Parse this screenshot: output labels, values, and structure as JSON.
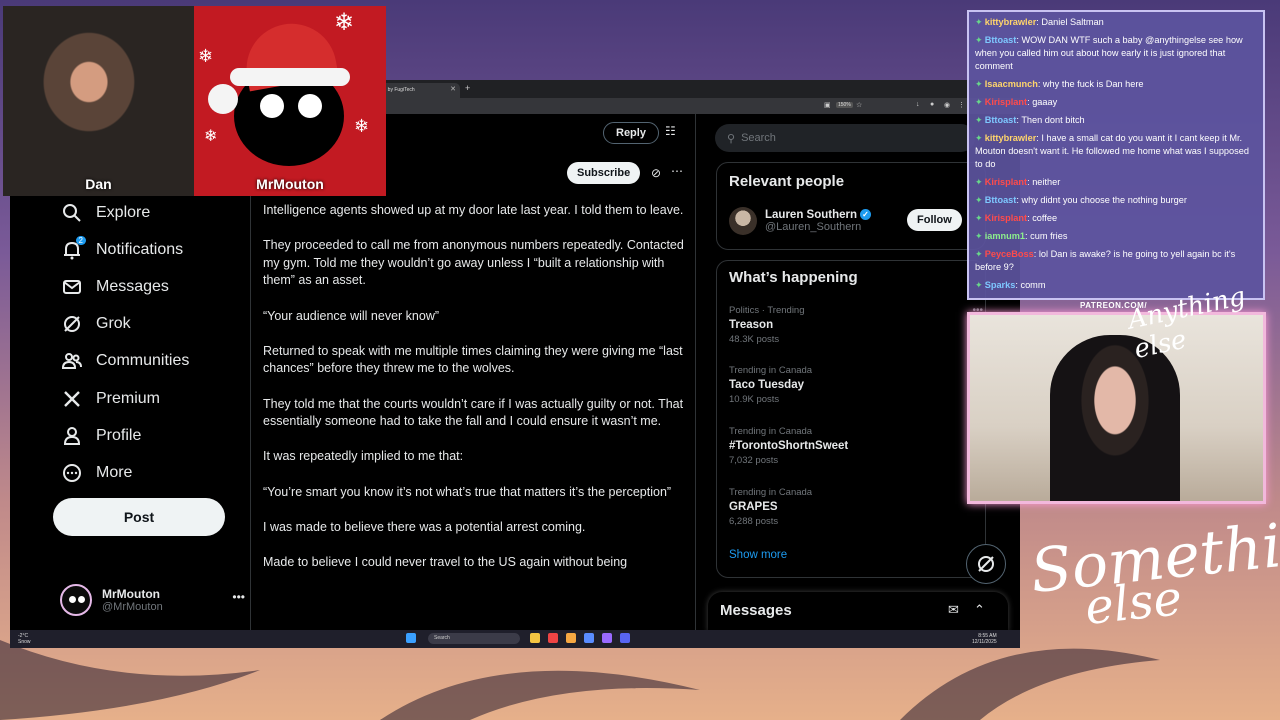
{
  "browser": {
    "tab_title": "ctive by FugiTech",
    "zoom": "150%"
  },
  "nav": {
    "items": [
      {
        "label": "Explore",
        "icon": "search-icon"
      },
      {
        "label": "Notifications",
        "icon": "bell-icon",
        "badge": "2"
      },
      {
        "label": "Messages",
        "icon": "mail-icon"
      },
      {
        "label": "Grok",
        "icon": "grok-icon"
      },
      {
        "label": "Communities",
        "icon": "people-icon"
      },
      {
        "label": "Premium",
        "icon": "x-logo-icon"
      },
      {
        "label": "Profile",
        "icon": "person-icon"
      },
      {
        "label": "More",
        "icon": "more-circle-icon"
      }
    ],
    "post_label": "Post",
    "account": {
      "name": "MrMouton",
      "handle": "@MrMouton"
    }
  },
  "center": {
    "reply_label": "Reply",
    "subscribe_label": "Subscribe",
    "tweet_paragraphs": [
      "Intelligence agents showed up at my door late last year. I told them to leave.",
      "They proceeded to call me from anonymous numbers repeatedly. Contacted my gym. Told me they wouldn’t go away unless I “built a relationship with them” as an asset.",
      "“Your audience will never know”",
      "Returned to speak with me multiple times claiming they were giving me “last chances” before they threw me to the wolves.",
      "They told me that the courts wouldn’t care if I was actually guilty or not. That essentially someone had to take the fall and I could ensure it wasn’t me.",
      "It was repeatedly implied to me that:",
      "“You’re smart you know it’s not what’s true that matters it’s the perception”",
      "I was made to believe there was a potential arrest coming.",
      "Made to believe I could never travel to the US again without being"
    ]
  },
  "right": {
    "search_placeholder": "Search",
    "relevant_title": "Relevant people",
    "person": {
      "name": "Lauren Southern",
      "handle": "@Lauren_Southern"
    },
    "follow_label": "Follow",
    "happening_title": "What’s happening",
    "trends": [
      {
        "category": "Politics · Trending",
        "name": "Treason",
        "count": "48.3K posts"
      },
      {
        "category": "Trending in Canada",
        "name": "Taco Tuesday",
        "count": "10.9K posts"
      },
      {
        "category": "Trending in Canada",
        "name": "#TorontoShortnSweet",
        "count": "7,032 posts"
      },
      {
        "category": "Trending in Canada",
        "name": "GRAPES",
        "count": "6,288 posts"
      }
    ],
    "show_more_label": "Show more",
    "messages_title": "Messages"
  },
  "taskbar": {
    "weather_temp": "-2°C",
    "weather_label": "Snow",
    "search_label": "Search",
    "time": "8:55 AM",
    "date": "12/11/2025"
  },
  "cams": {
    "dan_label": "Dan",
    "mouton_label": "MrMouton"
  },
  "chat": {
    "messages": [
      {
        "user": "kittybrawler",
        "user_color": "#ffd56b",
        "text": "Daniel Saltman"
      },
      {
        "user": "Bttoast",
        "user_color": "#7ec8ff",
        "text": "WOW DAN WTF such a baby @anythingelse see how when you called him out about how early it is just ignored that comment"
      },
      {
        "user": "Isaacmunch",
        "user_color": "#ffd56b",
        "text": "why the fuck is Dan here"
      },
      {
        "user": "Kirisplant",
        "user_color": "#ff4b4b",
        "text": "gaaay"
      },
      {
        "user": "Bttoast",
        "user_color": "#7ec8ff",
        "text": "Then dont bitch"
      },
      {
        "user": "kittybrawler",
        "user_color": "#ffd56b",
        "text": "I have a small cat do you want it I cant keep it Mr. Mouton doesn't want it. He followed me home what was I supposed to do"
      },
      {
        "user": "Kirisplant",
        "user_color": "#ff4b4b",
        "text": "neither"
      },
      {
        "user": "Bttoast",
        "user_color": "#7ec8ff",
        "text": "why didnt you choose the nothing burger"
      },
      {
        "user": "Kirisplant",
        "user_color": "#ff4b4b",
        "text": "coffee"
      },
      {
        "user": "iamnum1",
        "user_color": "#8cf08c",
        "text": "cum fries"
      },
      {
        "user": "PeyceBoss",
        "user_color": "#ff4b4b",
        "text": "lol Dan is awake? is he going to yell again bc it's before 9?"
      },
      {
        "user": "Sparks",
        "user_color": "#7ec8ff",
        "text": "comm"
      }
    ]
  },
  "branding": {
    "patreon": "PATREON.COM/",
    "anything_else": "Anything else",
    "something": "Something",
    "else": "else"
  },
  "colors": {
    "accent": "#1d9bf0",
    "x_bg": "#000000",
    "chat_bg": "#5c549e"
  }
}
